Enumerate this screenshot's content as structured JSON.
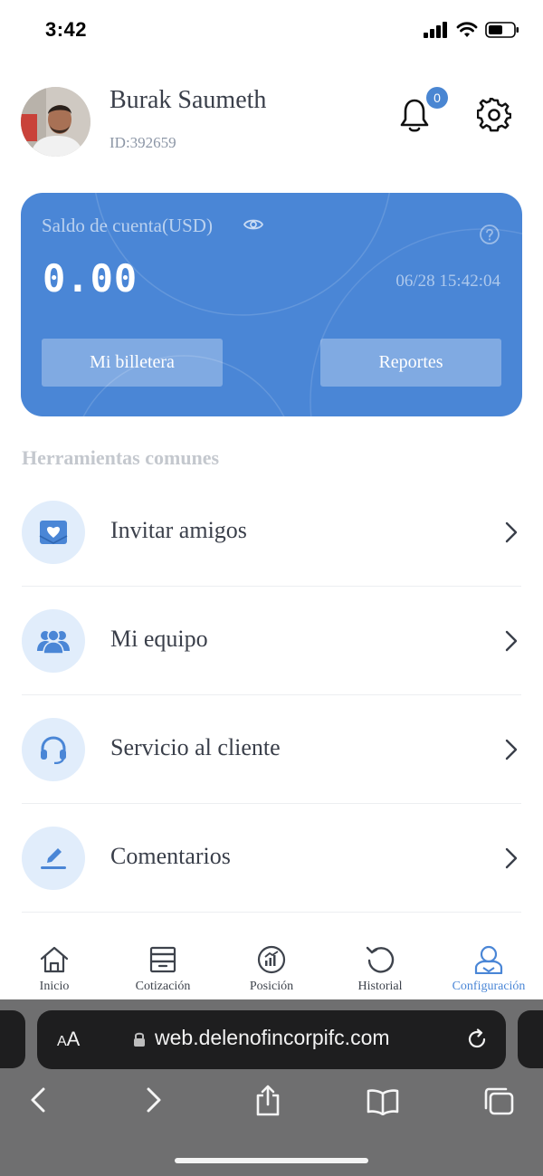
{
  "status_bar": {
    "time": "3:42"
  },
  "profile": {
    "name": "Burak Saumeth",
    "id": "ID:392659",
    "notification_count": "0"
  },
  "balance": {
    "label": "Saldo de cuenta(USD)",
    "amount": "0.00",
    "timestamp": "06/28 15:42:04",
    "wallet_button": "Mi billetera",
    "reports_button": "Reportes"
  },
  "tools": {
    "title": "Herramientas comunes",
    "items": [
      {
        "label": "Invitar amigos",
        "icon": "invite-icon"
      },
      {
        "label": "Mi equipo",
        "icon": "team-icon"
      },
      {
        "label": "Servicio al cliente",
        "icon": "headset-icon"
      },
      {
        "label": "Comentarios",
        "icon": "pen-icon"
      }
    ]
  },
  "tab_bar": {
    "active": "Configuración",
    "tabs": [
      {
        "label": "Inicio",
        "icon": "home-icon"
      },
      {
        "label": "Cotización",
        "icon": "quote-icon"
      },
      {
        "label": "Posición",
        "icon": "position-icon"
      },
      {
        "label": "Historial",
        "icon": "history-icon"
      },
      {
        "label": "Configuración",
        "icon": "user-icon"
      }
    ]
  },
  "browser": {
    "aa_large": "A",
    "aa_small": "A",
    "url": "web.delenofincorpifc.com"
  },
  "colors": {
    "accent": "#4a86d6",
    "icon_bg": "#e1edfb",
    "browser_bg": "#6f6f70"
  }
}
